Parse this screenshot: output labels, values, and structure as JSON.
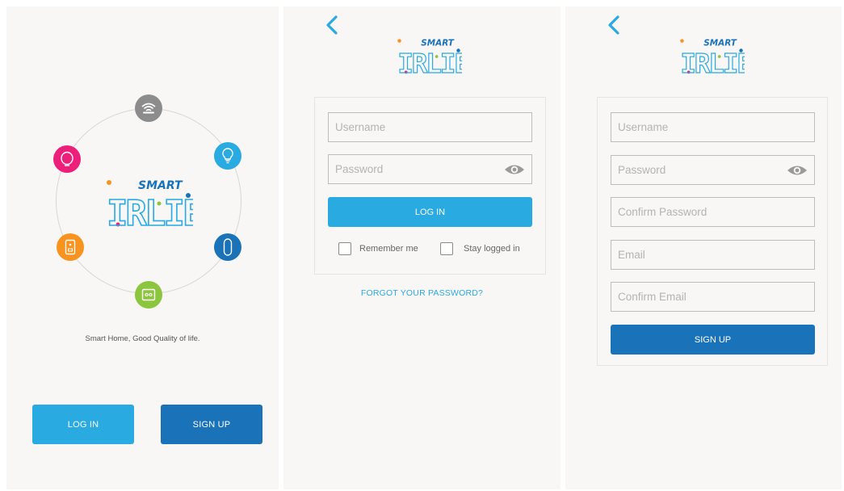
{
  "brand": {
    "smart": "SMART",
    "name": "IRLIE",
    "blue": "#29aae1",
    "dark_blue": "#1a73b8"
  },
  "welcome": {
    "tagline": "Smart Home, Good Quality of life.",
    "login_label": "LOG IN",
    "signup_label": "SIGN UP",
    "devices": [
      {
        "icon": "wifi-router-icon",
        "color": "#8c8c8c"
      },
      {
        "icon": "light-bulb-icon",
        "color": "#29aae1"
      },
      {
        "icon": "remote-control-icon",
        "color": "#1a73b8"
      },
      {
        "icon": "smart-plug-icon",
        "color": "#8cc63f"
      },
      {
        "icon": "wall-switch-icon",
        "color": "#f7931e"
      },
      {
        "icon": "nightlight-icon",
        "color": "#ec1f7a"
      }
    ]
  },
  "login": {
    "username_placeholder": "Username",
    "password_placeholder": "Password",
    "submit_label": "LOG IN",
    "remember_label": "Remember me",
    "stay_label": "Stay logged in",
    "forgot_label": "FORGOT YOUR PASSWORD?"
  },
  "signup": {
    "username_placeholder": "Username",
    "password_placeholder": "Password",
    "confirm_password_placeholder": "Confirm Password",
    "email_placeholder": "Email",
    "confirm_email_placeholder": "Confirm Email",
    "submit_label": "SIGN UP"
  }
}
